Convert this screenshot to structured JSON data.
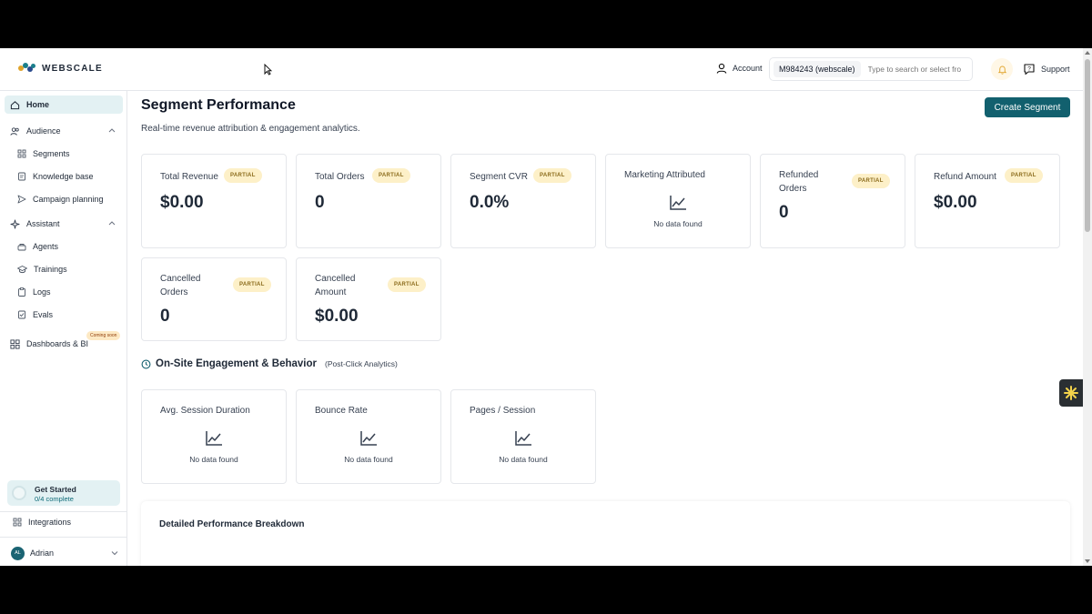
{
  "brand": {
    "name": "WEBSCALE",
    "colors": [
      "#e0a32a",
      "#1b7f8c",
      "#2a4b8d"
    ]
  },
  "topbar": {
    "account_label": "Account",
    "merchant_chip": "M984243 (webscale)",
    "merchant_placeholder": "Type to search or select fro",
    "support_label": "Support"
  },
  "sidebar": {
    "home": "Home",
    "audience": "Audience",
    "segments": "Segments",
    "knowledge_base": "Knowledge base",
    "campaign_planning": "Campaign planning",
    "assistant": "Assistant",
    "agents": "Agents",
    "trainings": "Trainings",
    "logs": "Logs",
    "evals": "Evals",
    "dashboards": "Dashboards & BI",
    "coming_soon": "Coming soon",
    "get_started_title": "Get Started",
    "get_started_sub": "0/4 complete",
    "integrations": "Integrations",
    "user_initials": "AL",
    "user_name": "Adrian"
  },
  "main": {
    "title": "Segment Performance",
    "subtitle": "Real-time revenue attribution & engagement analytics.",
    "create_button": "Create Segment",
    "badge": "PARTIAL",
    "no_data": "No data found",
    "metrics": [
      {
        "title": "Total Revenue",
        "value": "$0.00"
      },
      {
        "title": "Total Orders",
        "value": "0"
      },
      {
        "title": "Segment CVR",
        "value": "0.0%"
      },
      {
        "title": "Marketing Attributed"
      },
      {
        "title": "Refunded Orders",
        "value": "0"
      },
      {
        "title": "Refund Amount",
        "value": "$0.00"
      },
      {
        "title": "Cancelled Orders",
        "value": "0"
      },
      {
        "title": "Cancelled Amount",
        "value": "$0.00"
      }
    ],
    "engagement": {
      "title": "On-Site Engagement & Behavior",
      "subtitle": "(Post-Click Analytics)",
      "cards": [
        {
          "title": "Avg. Session Duration"
        },
        {
          "title": "Bounce Rate"
        },
        {
          "title": "Pages / Session"
        }
      ]
    },
    "breakdown_title": "Detailed Performance Breakdown"
  },
  "accent_color": "#12606e"
}
